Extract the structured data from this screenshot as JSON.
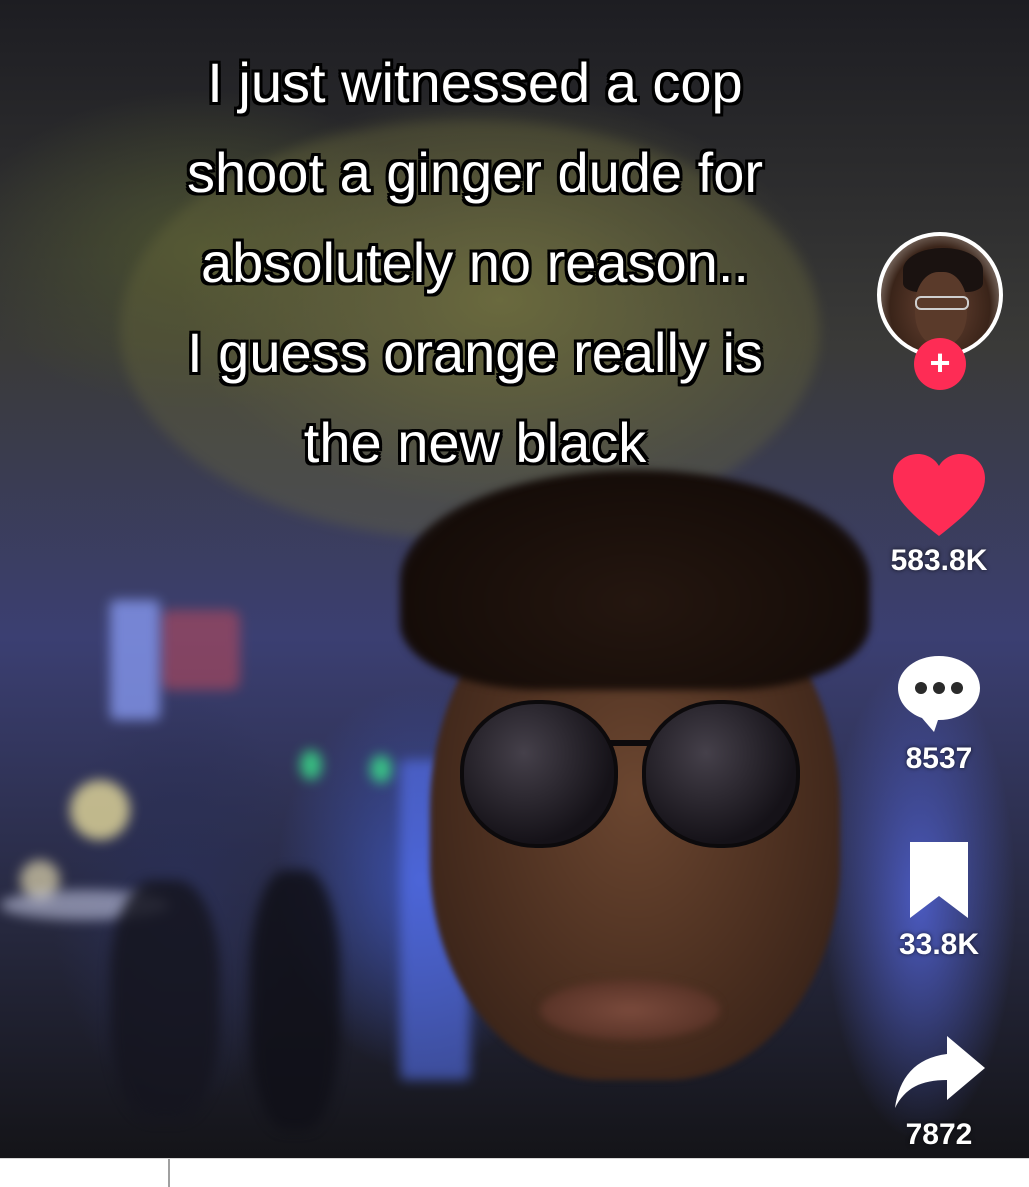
{
  "video": {
    "caption_lines": [
      "I just witnessed a cop",
      "shoot a ginger dude for",
      "absolutely no reason..",
      "I guess orange really is",
      "the new black"
    ]
  },
  "sidebar": {
    "avatar_icon": "profile-avatar",
    "follow_label": "+",
    "like": {
      "icon": "heart-icon",
      "count": "583.8K",
      "color": "#fe2c55"
    },
    "comment": {
      "icon": "comment-bubble-icon",
      "count": "8537"
    },
    "save": {
      "icon": "bookmark-icon",
      "count": "33.8K"
    },
    "share": {
      "icon": "share-arrow-icon",
      "count": "7872"
    }
  },
  "colors": {
    "accent": "#fe2c55",
    "caption_text": "#ffffff",
    "caption_outline": "#000000"
  }
}
